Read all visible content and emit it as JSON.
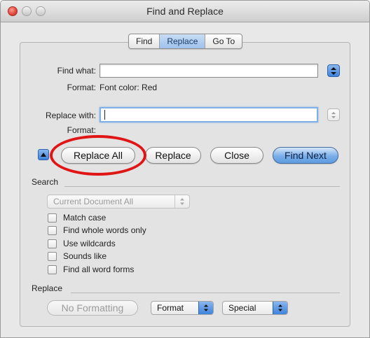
{
  "window": {
    "title": "Find and Replace"
  },
  "tabs": [
    {
      "label": "Find",
      "active": false
    },
    {
      "label": "Replace",
      "active": true
    },
    {
      "label": "Go To",
      "active": false
    }
  ],
  "find": {
    "label": "Find what:",
    "value": "",
    "format_label": "Format:",
    "format_value": "Font color: Red"
  },
  "replace_field": {
    "label": "Replace with:",
    "value": "",
    "format_label": "Format:",
    "format_value": ""
  },
  "buttons": {
    "replace_all": "Replace All",
    "replace": "Replace",
    "close": "Close",
    "find_next": "Find Next"
  },
  "search": {
    "heading": "Search",
    "scope": "Current Document All",
    "options": [
      {
        "label": "Match case",
        "checked": false
      },
      {
        "label": "Find whole words only",
        "checked": false
      },
      {
        "label": "Use wildcards",
        "checked": false
      },
      {
        "label": "Sounds like",
        "checked": false
      },
      {
        "label": "Find all word forms",
        "checked": false
      }
    ]
  },
  "replace_section": {
    "heading": "Replace",
    "no_formatting": "No Formatting",
    "format_menu": "Format",
    "special_menu": "Special"
  },
  "colors": {
    "accent": "#3f82dc",
    "highlight_circle": "#e01616",
    "default_button": "#7aaee9"
  },
  "icons": {
    "close": "close-window-icon",
    "minimize": "minimize-window-icon",
    "zoom": "zoom-window-icon",
    "stepper": "up-down-arrows-icon",
    "disclosure": "disclosure-triangle-icon"
  }
}
